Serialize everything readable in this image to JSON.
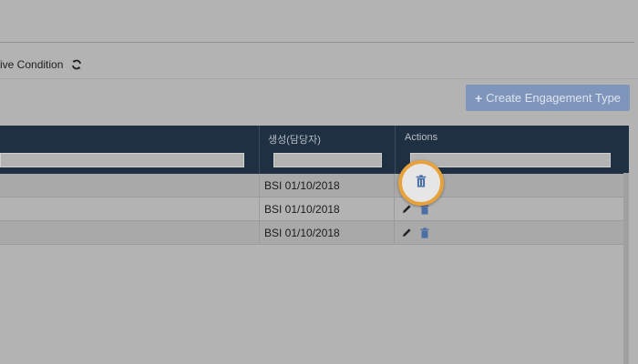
{
  "filter_bar": {
    "label": "ive Condition",
    "refresh_icon": "refresh-icon"
  },
  "toolbar": {
    "create_label": "Create Engagement Type",
    "create_icon": "plus-icon"
  },
  "table": {
    "columns": [
      "",
      "생성(담당자)",
      "Actions"
    ],
    "rows": [
      {
        "name": "",
        "created": "BSI 01/10/2018"
      },
      {
        "name": "",
        "created": "BSI 01/10/2018"
      },
      {
        "name": "",
        "created": "BSI 01/10/2018"
      }
    ]
  },
  "colors": {
    "header_bg": "#1f3043",
    "button_bg": "#7f95bb",
    "highlight_ring": "#e8a23c",
    "action_icon": "#4a6fa5"
  }
}
